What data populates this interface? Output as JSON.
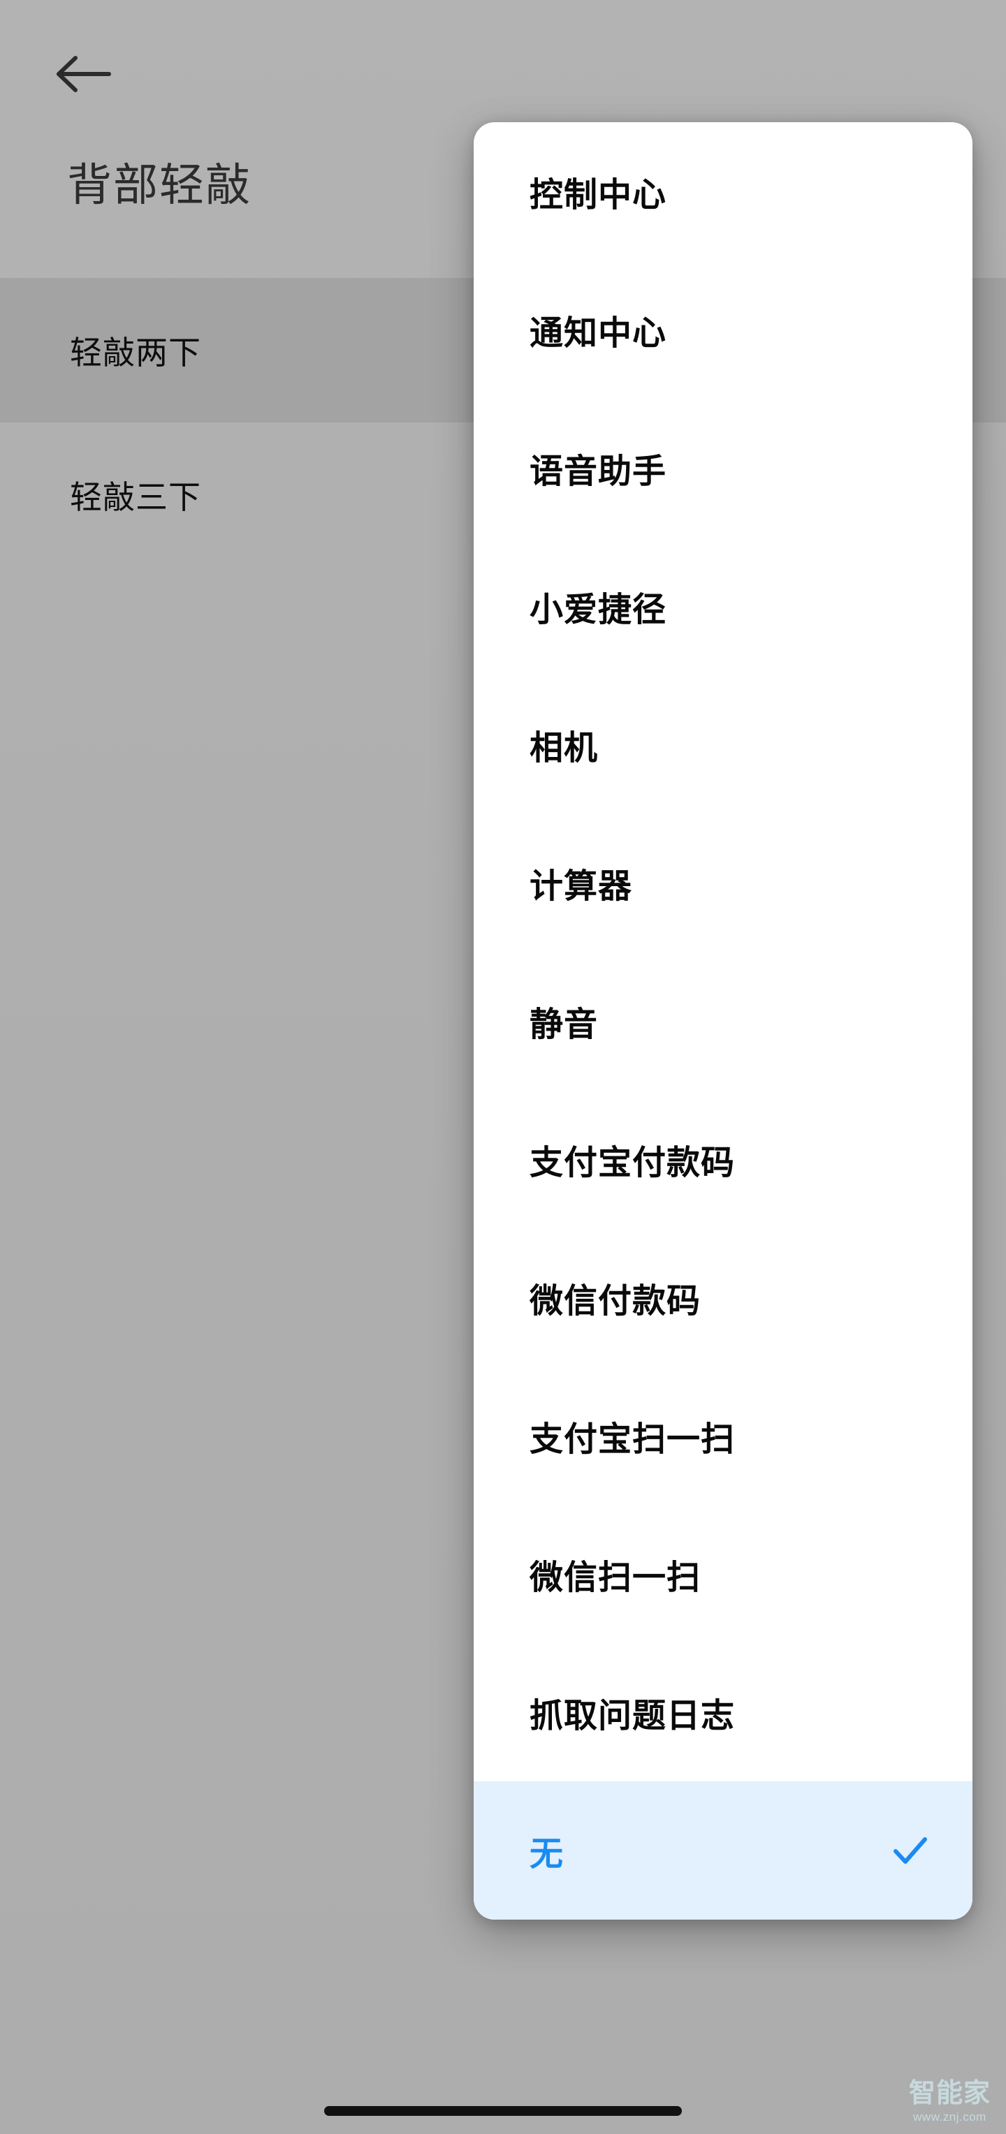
{
  "app": {
    "screen_title": "背部轻敲",
    "background_color": "#aeaeae",
    "accent_color": "#1a8bf0",
    "selected_row_color": "#e3f0fd"
  },
  "header": {
    "back_icon": "arrow-left-icon",
    "title": "背部轻敲"
  },
  "settings_list": {
    "items": [
      {
        "label": "轻敲两下",
        "pressed": true
      },
      {
        "label": "轻敲三下",
        "pressed": false
      }
    ]
  },
  "dropdown": {
    "selected_value": "无",
    "check_icon": "check-icon",
    "items": [
      {
        "label": "控制中心",
        "selected": false
      },
      {
        "label": "通知中心",
        "selected": false
      },
      {
        "label": "语音助手",
        "selected": false
      },
      {
        "label": "小爱捷径",
        "selected": false
      },
      {
        "label": "相机",
        "selected": false
      },
      {
        "label": "计算器",
        "selected": false
      },
      {
        "label": "静音",
        "selected": false
      },
      {
        "label": "支付宝付款码",
        "selected": false
      },
      {
        "label": "微信付款码",
        "selected": false
      },
      {
        "label": "支付宝扫一扫",
        "selected": false
      },
      {
        "label": "微信扫一扫",
        "selected": false
      },
      {
        "label": "抓取问题日志",
        "selected": false
      },
      {
        "label": "无",
        "selected": true
      }
    ]
  },
  "system": {
    "gesture_bar": "home-indicator"
  },
  "watermark": {
    "brand": "智能家",
    "url": "www.znj.com"
  }
}
